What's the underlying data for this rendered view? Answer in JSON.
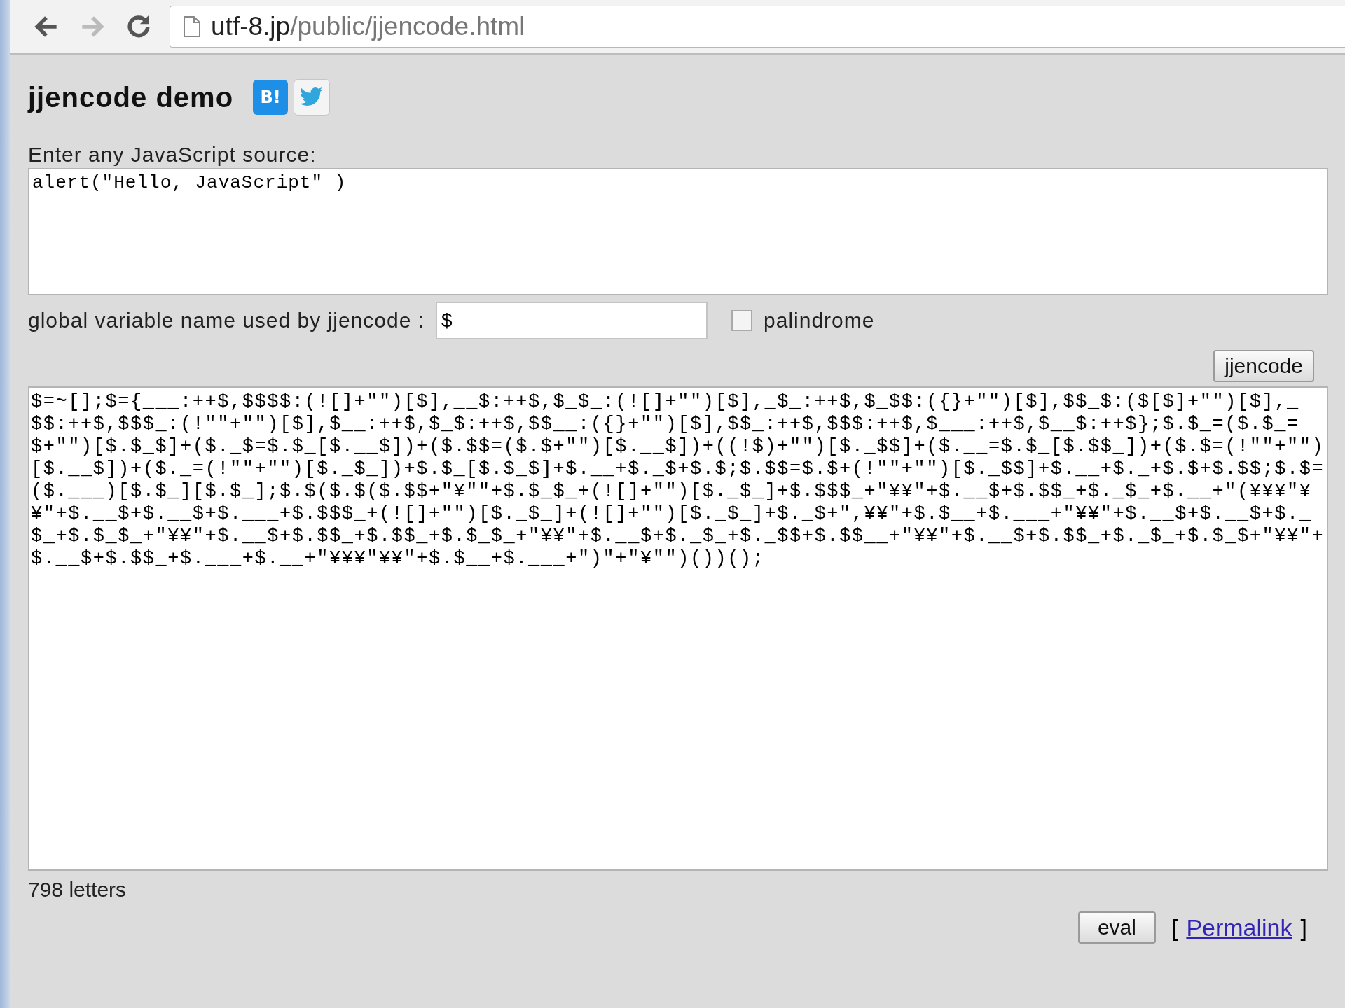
{
  "browser": {
    "url_host": "utf-8.jp",
    "url_path": "/public/jjencode.html"
  },
  "page": {
    "title": "jjencode demo",
    "hatena_button": {
      "label": "B!"
    },
    "source_label": "Enter any JavaScript source:",
    "source": "alert(\"Hello, JavaScript\" )",
    "variable_label": "global variable name used by jjencode :",
    "variable": "$",
    "palindrome": {
      "label": "palindrome",
      "checked": false
    },
    "encode_button": "jjencode",
    "output": "$=~[];$={___:++$,$$$$:(![]+\"\")[$],__$:++$,$_$_:(![]+\"\")[$],_$_:++$,$_$$:({}+\"\")[$],$$_$:($[$]+\"\")[$],_$$:++$,$$$_:(!\"\"+\"\")[$],$__:++$,$_$:++$,$$__:({}+\"\")[$],$$_:++$,$$$:++$,$___:++$,$__$:++$};$.$_=($.$_=$+\"\")[$.$_$]+($._$=$.$_[$.__$])+($.$$=($.$+\"\")[$.__$])+((!$)+\"\")[$._$$]+($.__=$.$_[$.$$_])+($.$=(!\"\"+\"\")[$.__$])+($._=(!\"\"+\"\")[$._$_])+$.$_[$.$_$]+$.__+$._$+$.$;$.$$=$.$+(!\"\"+\"\")[$._$$]+$.__+$._+$.$+$.$$;$.$=($.___)[$.$_][$.$_];$.$($.$($.$$+\"¥\"\"+$.$_$_+(![]+\"\")[$._$_]+$.$$$_+\"¥¥\"+$.__$+$.$$_+$._$_+$.__+\"(¥¥¥\"¥¥\"+$.__$+$.__$+$.___+$.$$$_+(![]+\"\")[$._$_]+(![]+\"\")[$._$_]+$._$+\",¥¥\"+$.$__+$.___+\"¥¥\"+$.__$+$.__$+$._$_+$.$_$_+\"¥¥\"+$.__$+$.$$_+$.$$_+$.$_$_+\"¥¥\"+$.__$+$._$_+$._$$+$.$$__+\"¥¥\"+$.__$+$.$$_+$._$_+$.$_$+\"¥¥\"+$.__$+$.$$_+$.___+$.__+\"¥¥¥\"¥¥\"+$.$__+$.___+\")\"+\"¥\"\")())();",
    "count": "798 letters",
    "eval_button": "eval",
    "bracket_open": "[",
    "permalink": "Permalink",
    "bracket_close": "]"
  }
}
